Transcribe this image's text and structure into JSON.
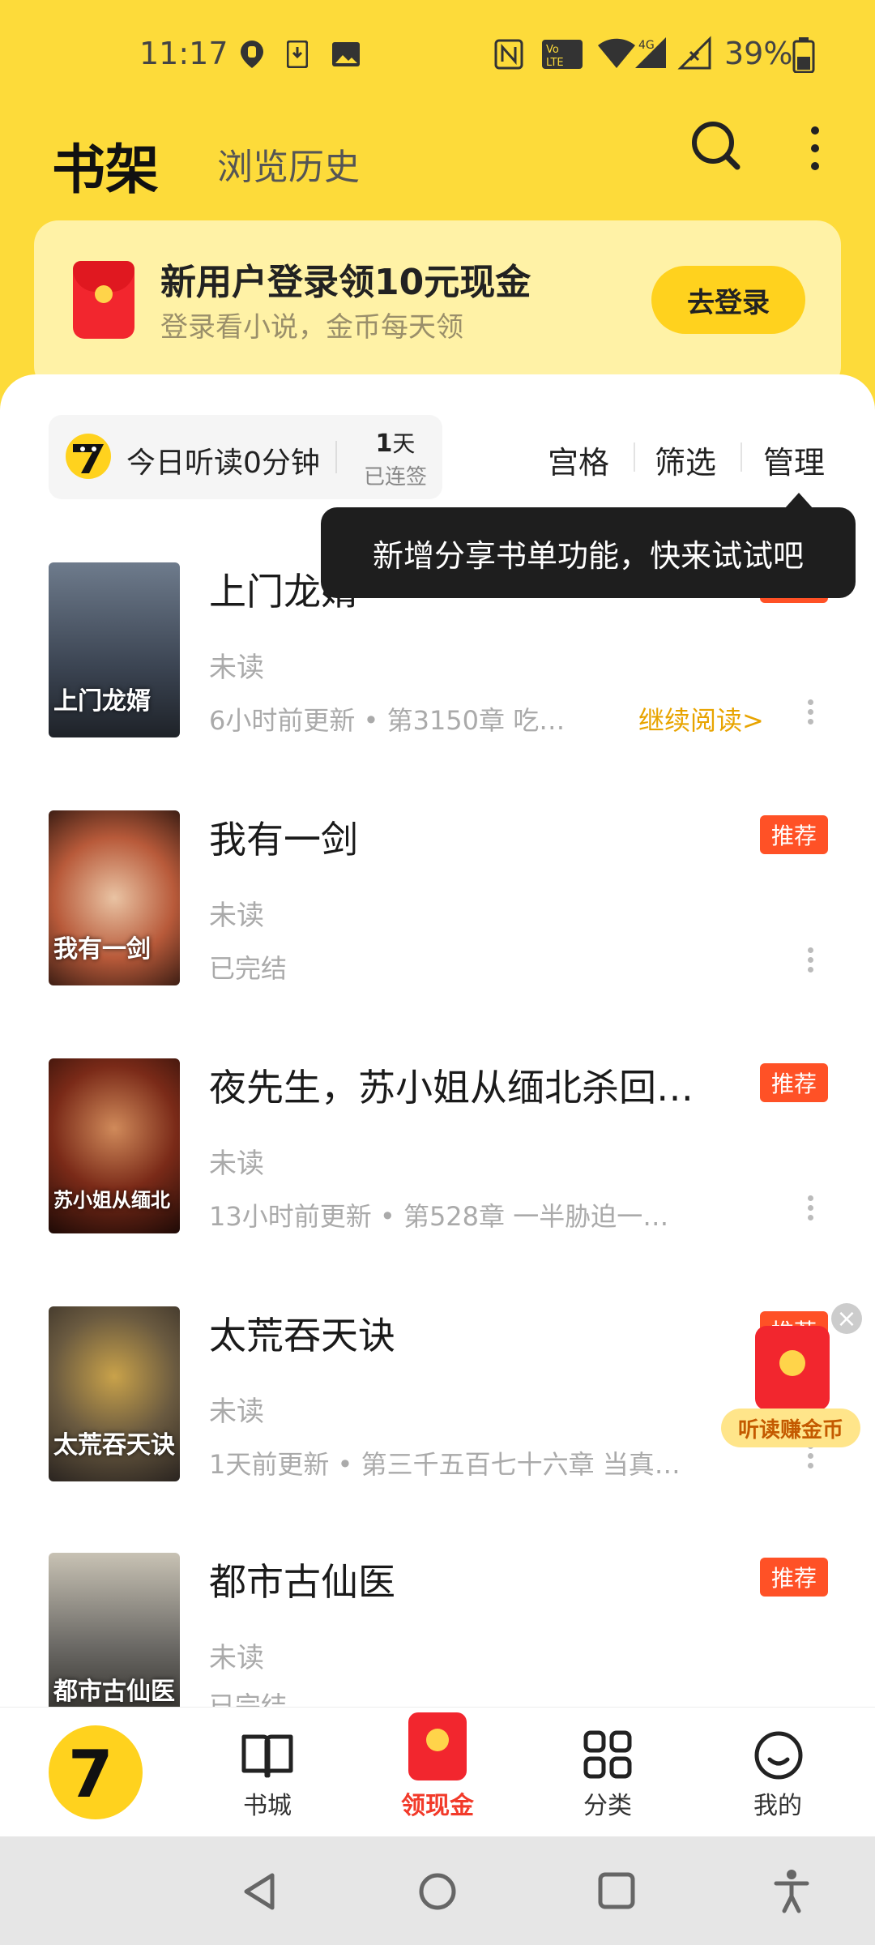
{
  "status_bar": {
    "time": "11:17",
    "battery": "39%",
    "network": "4G"
  },
  "header": {
    "title": "书架",
    "history_tab": "浏览历史"
  },
  "promo": {
    "title": "新用户登录领10元现金",
    "subtitle": "登录看小说，金币每天领",
    "button": "去登录"
  },
  "listen": {
    "text": "今日听读0分钟",
    "days": "1",
    "days_unit": "天",
    "streak": "已连签"
  },
  "toolbar": {
    "grid": "宫格",
    "filter": "筛选",
    "manage": "管理"
  },
  "tooltip": "新增分享书单功能，快来试试吧",
  "books": [
    {
      "title": "上门龙婿",
      "status": "未读",
      "meta": "6小时前更新  •  第3150章 吃…",
      "continue": "继续阅读>",
      "badge": "推荐",
      "cover_text": "上门龙婿",
      "cover_color": "#3b4452"
    },
    {
      "title": "我有一剑",
      "status": "未读",
      "meta": "已完结",
      "badge": "推荐",
      "cover_text": "我有一剑",
      "cover_color": "#c9a58a"
    },
    {
      "title": "夜先生，苏小姐从缅北杀回…",
      "status": "未读",
      "meta": "13小时前更新  •  第528章  一半胁迫一…",
      "badge": "推荐",
      "cover_text": "苏小姐从缅北",
      "cover_color": "#5a2418"
    },
    {
      "title": "太荒吞天诀",
      "status": "未读",
      "meta": "1天前更新  •  第三千五百七十六章  当真…",
      "badge": "推荐",
      "cover_text": "太荒吞天诀",
      "cover_color": "#463d34"
    },
    {
      "title": "都市古仙医",
      "status": "未读",
      "meta": "已完结",
      "badge": "推荐",
      "cover_text": "都市古仙医",
      "cover_color": "#6c6a66"
    }
  ],
  "float": {
    "label": "听读赚金币"
  },
  "bottom_nav": {
    "bookstore": "书城",
    "cash": "领现金",
    "category": "分类",
    "mine": "我的",
    "logo": "7"
  },
  "colors": {
    "brand_yellow": "#FDDB3A",
    "badge_red": "#FF5126",
    "accent_orange": "#E8A400"
  }
}
